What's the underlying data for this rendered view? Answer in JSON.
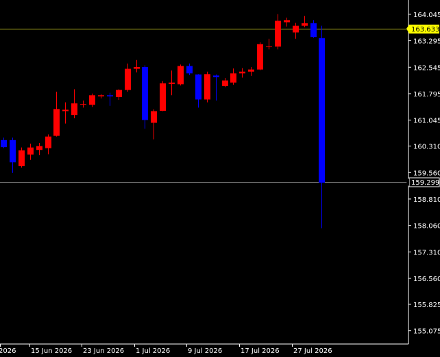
{
  "chart_data": {
    "type": "candlestick",
    "title": "",
    "xlabel": "",
    "ylabel": "",
    "ylim": [
      154.7,
      164.45
    ],
    "grid": false,
    "y_ticks": [
      "164.045",
      "163.295",
      "162.545",
      "161.795",
      "161.045",
      "160.310",
      "159.560",
      "158.810",
      "158.060",
      "157.310",
      "156.560",
      "155.825",
      "155.075"
    ],
    "x_ticks": [
      "2026",
      "15 Jun 2026",
      "23 Jun 2026",
      "1 Jul 2026",
      "9 Jul 2026",
      "17 Jul 2026",
      "27 Jul 2026"
    ],
    "price_lines": [
      {
        "label": "163.633",
        "value": 163.633,
        "line_color": "#b8b820",
        "tag_bg": "#ffff00",
        "tag_fg": "#000000"
      },
      {
        "label": "159.299",
        "value": 159.299,
        "line_color": "#8a8a8a",
        "tag_bg": "#000000",
        "tag_fg": "#ffffff"
      }
    ],
    "colors": {
      "background": "#000000",
      "up": "#ff0000",
      "down": "#0000ff",
      "axis": "#ffffff"
    },
    "candles": [
      {
        "o": 160.48,
        "h": 160.55,
        "l": 160.25,
        "c": 160.28
      },
      {
        "o": 160.48,
        "h": 160.55,
        "l": 159.55,
        "c": 159.85
      },
      {
        "o": 159.74,
        "h": 160.27,
        "l": 159.7,
        "c": 160.19
      },
      {
        "o": 160.07,
        "h": 160.38,
        "l": 159.92,
        "c": 160.27
      },
      {
        "o": 160.2,
        "h": 160.4,
        "l": 160.05,
        "c": 160.31
      },
      {
        "o": 160.25,
        "h": 160.64,
        "l": 160.08,
        "c": 160.58
      },
      {
        "o": 160.6,
        "h": 161.85,
        "l": 160.58,
        "c": 161.36
      },
      {
        "o": 161.3,
        "h": 161.55,
        "l": 160.95,
        "c": 161.34
      },
      {
        "o": 161.19,
        "h": 161.92,
        "l": 161.1,
        "c": 161.52
      },
      {
        "o": 161.48,
        "h": 161.6,
        "l": 161.4,
        "c": 161.5
      },
      {
        "o": 161.48,
        "h": 161.8,
        "l": 161.42,
        "c": 161.75
      },
      {
        "o": 161.72,
        "h": 161.78,
        "l": 161.66,
        "c": 161.75
      },
      {
        "o": 161.75,
        "h": 161.82,
        "l": 161.45,
        "c": 161.72
      },
      {
        "o": 161.7,
        "h": 161.92,
        "l": 161.62,
        "c": 161.9
      },
      {
        "o": 161.9,
        "h": 162.65,
        "l": 161.85,
        "c": 162.5
      },
      {
        "o": 162.5,
        "h": 162.75,
        "l": 162.4,
        "c": 162.55
      },
      {
        "o": 162.55,
        "h": 162.6,
        "l": 160.8,
        "c": 161.05
      },
      {
        "o": 160.97,
        "h": 161.35,
        "l": 160.5,
        "c": 161.3
      },
      {
        "o": 161.31,
        "h": 162.15,
        "l": 161.3,
        "c": 162.09
      },
      {
        "o": 162.07,
        "h": 162.45,
        "l": 161.75,
        "c": 162.11
      },
      {
        "o": 162.06,
        "h": 162.62,
        "l": 162.03,
        "c": 162.58
      },
      {
        "o": 162.58,
        "h": 162.65,
        "l": 162.32,
        "c": 162.37
      },
      {
        "o": 162.34,
        "h": 162.35,
        "l": 161.4,
        "c": 161.63
      },
      {
        "o": 161.63,
        "h": 162.42,
        "l": 161.55,
        "c": 162.35
      },
      {
        "o": 162.31,
        "h": 162.34,
        "l": 161.6,
        "c": 162.26
      },
      {
        "o": 162.01,
        "h": 162.24,
        "l": 161.98,
        "c": 162.17
      },
      {
        "o": 162.11,
        "h": 162.51,
        "l": 162.05,
        "c": 162.37
      },
      {
        "o": 162.37,
        "h": 162.52,
        "l": 162.25,
        "c": 162.42
      },
      {
        "o": 162.42,
        "h": 162.55,
        "l": 162.3,
        "c": 162.48
      },
      {
        "o": 162.48,
        "h": 163.25,
        "l": 162.46,
        "c": 163.2
      },
      {
        "o": 163.13,
        "h": 163.35,
        "l": 163.05,
        "c": 163.14
      },
      {
        "o": 163.13,
        "h": 164.05,
        "l": 163.05,
        "c": 163.86
      },
      {
        "o": 163.82,
        "h": 163.95,
        "l": 163.7,
        "c": 163.88
      },
      {
        "o": 163.53,
        "h": 163.8,
        "l": 163.35,
        "c": 163.72
      },
      {
        "o": 163.72,
        "h": 164.0,
        "l": 163.68,
        "c": 163.79
      },
      {
        "o": 163.79,
        "h": 163.88,
        "l": 163.38,
        "c": 163.4
      },
      {
        "o": 163.37,
        "h": 163.72,
        "l": 157.98,
        "c": 159.27
      }
    ]
  }
}
